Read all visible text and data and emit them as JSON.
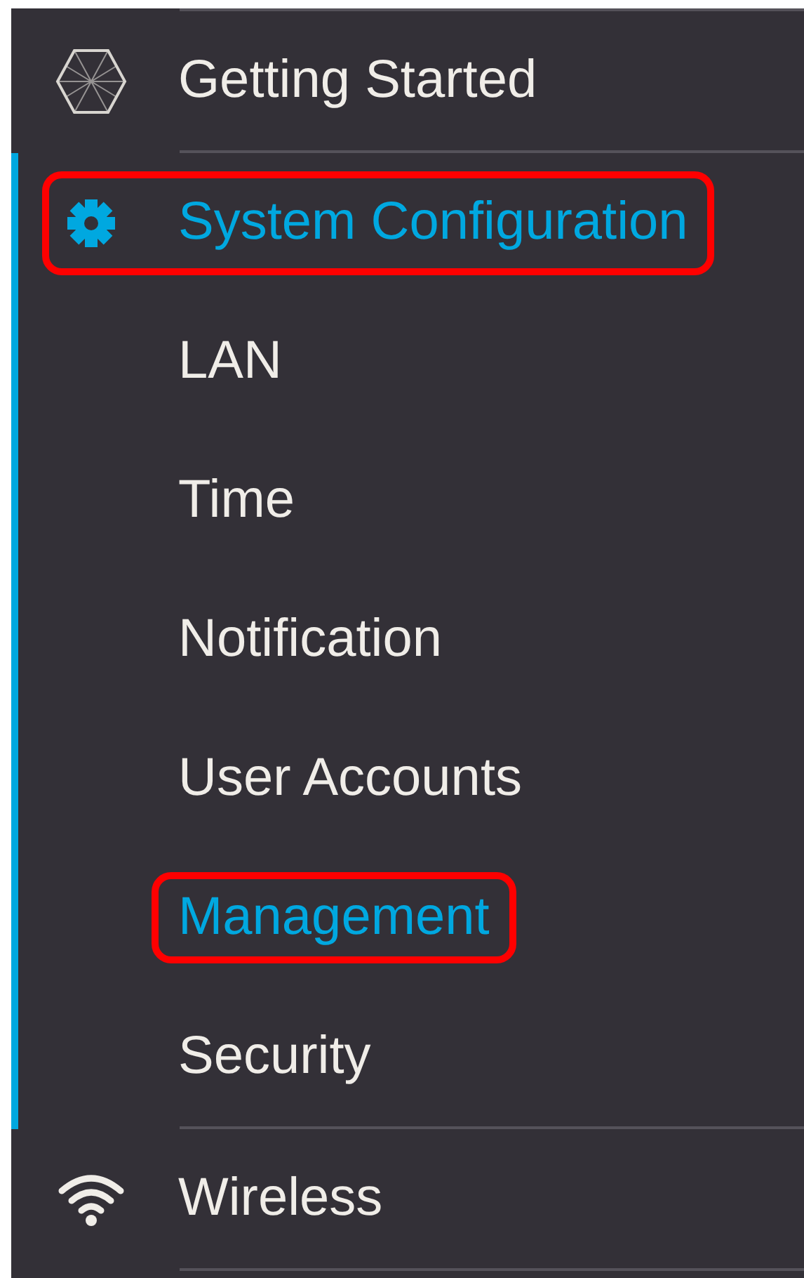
{
  "sidebar": {
    "items": [
      {
        "label": "Getting Started",
        "kind": "hexagon",
        "selected": false,
        "highlighted": false,
        "expanded": false
      },
      {
        "label": "System Configuration",
        "kind": "gear",
        "selected": true,
        "highlighted": true,
        "expanded": true,
        "children": [
          {
            "label": "LAN",
            "selected": false,
            "highlighted": false
          },
          {
            "label": "Time",
            "selected": false,
            "highlighted": false
          },
          {
            "label": "Notification",
            "selected": false,
            "highlighted": false
          },
          {
            "label": "User Accounts",
            "selected": false,
            "highlighted": false
          },
          {
            "label": "Management",
            "selected": true,
            "highlighted": true
          },
          {
            "label": "Security",
            "selected": false,
            "highlighted": false
          }
        ]
      },
      {
        "label": "Wireless",
        "kind": "wifi",
        "selected": false,
        "highlighted": false,
        "expanded": false
      }
    ]
  }
}
